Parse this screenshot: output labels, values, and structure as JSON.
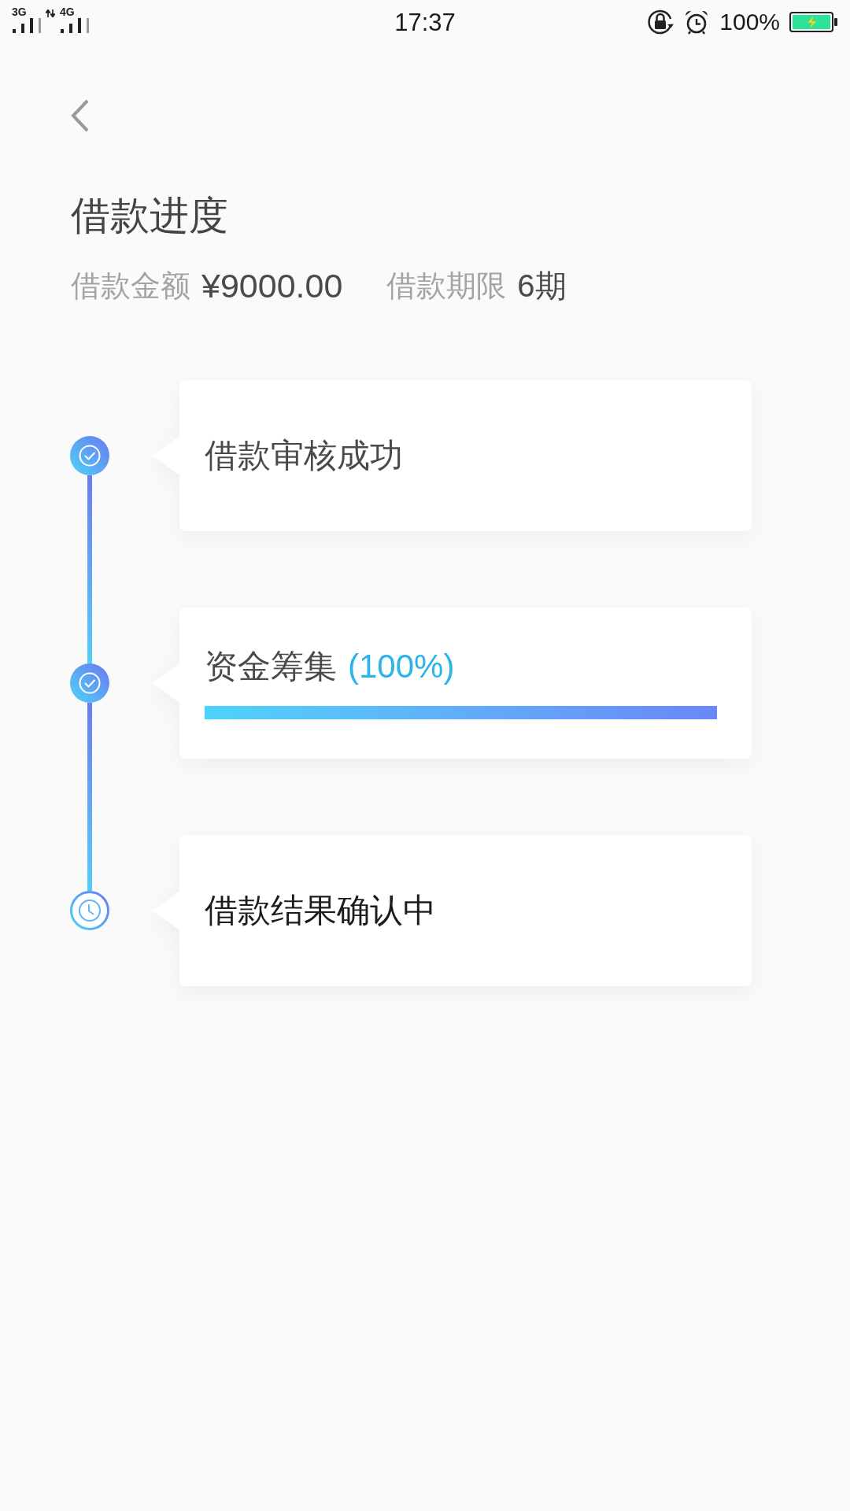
{
  "status_bar": {
    "network_1": "3G",
    "network_2": "4G",
    "time": "17:37",
    "battery": "100%"
  },
  "header": {
    "title": "借款进度",
    "amount_label": "借款金额",
    "amount": "¥9000.00",
    "term_label": "借款期限",
    "term": "6期"
  },
  "steps": [
    {
      "label": "借款审核成功",
      "completed": true
    },
    {
      "label": "资金筹集",
      "percent": "(100%)",
      "level": 1,
      "completed": true
    },
    {
      "label": "借款结果确认中",
      "completed": false
    }
  ]
}
